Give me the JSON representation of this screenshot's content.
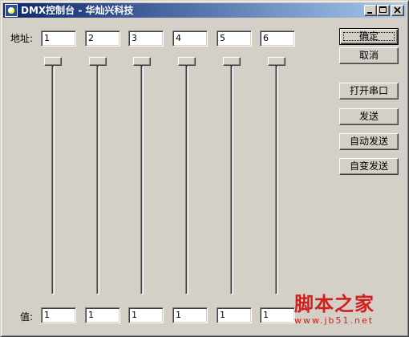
{
  "window": {
    "title": "DMX控制台 - 华灿兴科技",
    "controls": [
      "minimize",
      "maximize",
      "close"
    ]
  },
  "address": {
    "label": "地址:",
    "values": [
      "1",
      "2",
      "3",
      "4",
      "5",
      "6"
    ]
  },
  "sliders": {
    "levels": [
      0,
      0,
      0,
      0,
      0,
      0
    ]
  },
  "value": {
    "label": "值:",
    "values": [
      "1",
      "1",
      "1",
      "1",
      "1",
      "1"
    ]
  },
  "buttons": {
    "ok": "确定",
    "cancel": "取消",
    "open_port": "打开串口",
    "send": "发送",
    "auto_send": "自动发送",
    "change_send": "自变发送"
  },
  "watermark": {
    "text": "脚本之家",
    "url": "www.jb51.net"
  },
  "colors": {
    "face": "#d4d0c8",
    "title_start": "#0a246a",
    "title_end": "#a6caf0",
    "watermark": "#d0201e"
  }
}
